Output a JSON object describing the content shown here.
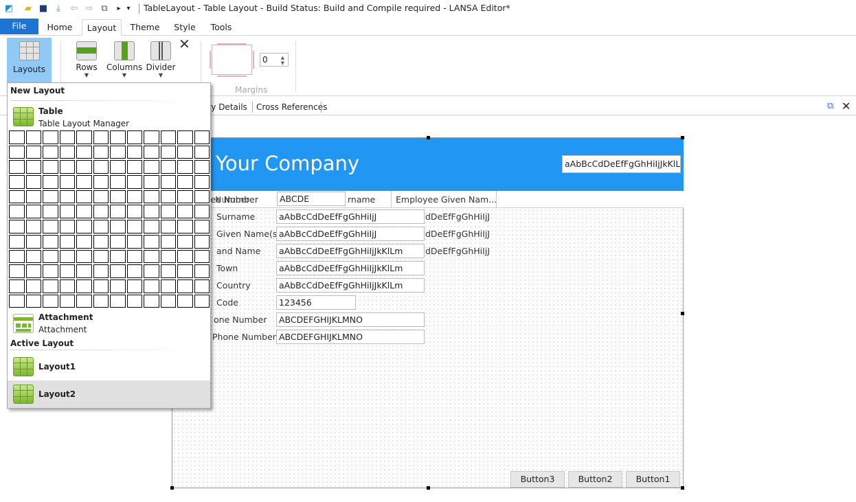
{
  "window": {
    "title": "TableLayout - Table Layout -   Build Status: Build and Compile required - LANSA Editor*"
  },
  "qat": {
    "icons": [
      "app-logo-icon",
      "open-folder-icon",
      "save-icon",
      "install-icon",
      "back-icon",
      "forward-icon",
      "popout-icon",
      "more-icon",
      "customize-icon"
    ],
    "more": "▸",
    "customize": "▾"
  },
  "ribbon_tabs": [
    "File",
    "Home",
    "Layout",
    "Theme",
    "Style",
    "Tools"
  ],
  "ribbon": {
    "layouts": "Layouts",
    "rows": "Rows",
    "columns": "Columns",
    "divider": "Divider",
    "margin_value": "0",
    "margins": "Margins"
  },
  "doc_tabs": [
    "ory Details",
    "Cross References"
  ],
  "menu": {
    "new_layout": "New Layout",
    "table_title": "Table",
    "table_sub": "Table Layout Manager",
    "grid_rows": 12,
    "grid_cols": 12,
    "attachment_title": "Attachment",
    "attachment_sub": "Attachment",
    "active_layout": "Active Layout",
    "items": [
      "Layout1",
      "Layout2"
    ],
    "selected": "Layout2"
  },
  "form": {
    "company": "Your Company",
    "header_input": "aAbBcCdDeEfFgGhHiIjJkKlLm",
    "header_row": {
      "label_a": "yee Number",
      "label_b": "Number",
      "input": "ABCDE",
      "col2": "rname",
      "col3": "Employee Given Nam..."
    },
    "rows": [
      {
        "label": "Surname",
        "value": "aAbBcCdDeEfFgGhHiIjJ",
        "extra": "dDeEfFgGhHiIjJ"
      },
      {
        "label": "Given Name(s",
        "value": "aAbBcCdDeEfFgGhHiIjJ",
        "extra": "dDeEfFgGhHiIjJ"
      },
      {
        "label": "and Name",
        "value": "aAbBcCdDeEfFgGhHiIjJkKlLm",
        "extra": "dDeEfFgGhHiIjJ"
      },
      {
        "label": "Town",
        "value": "aAbBcCdDeEfFgGhHiIjJkKlLm"
      },
      {
        "label": "Country",
        "value": "aAbBcCdDeEfFgGhHiIjJkKlLm"
      },
      {
        "label": "Code",
        "value": "123456"
      },
      {
        "label": "one Number",
        "value": "ABCDEFGHIJKLMNO"
      },
      {
        "label": "Phone Number",
        "value": "ABCDEFGHIJKLMNO"
      }
    ],
    "buttons": [
      "Button3",
      "Button2",
      "Button1"
    ]
  },
  "colors": {
    "accent": "#2196f3",
    "file_tab": "#1e74d3",
    "layouts_selected": "#90c8f6"
  }
}
